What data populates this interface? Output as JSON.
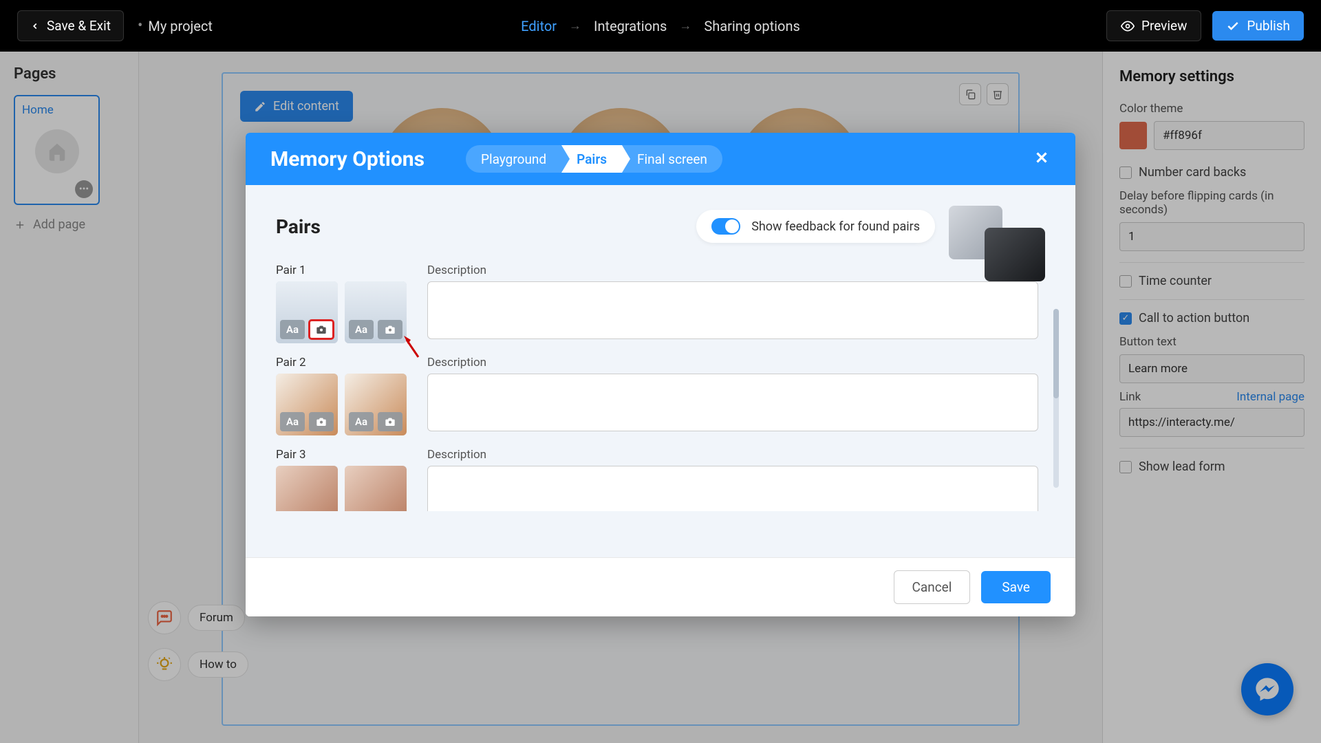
{
  "topbar": {
    "save_exit": "Save & Exit",
    "project_name": "My project",
    "nav": {
      "editor": "Editor",
      "integrations": "Integrations",
      "sharing": "Sharing options"
    },
    "preview": "Preview",
    "publish": "Publish"
  },
  "left_panel": {
    "title": "Pages",
    "home_label": "Home",
    "add_page": "Add page"
  },
  "canvas": {
    "edit_content": "Edit content"
  },
  "right_panel": {
    "title": "Memory settings",
    "color_theme_label": "Color theme",
    "color_hex": "#ff896f",
    "number_backs": "Number card backs",
    "delay_label": "Delay before flipping cards (in seconds)",
    "delay_value": "1",
    "time_counter": "Time counter",
    "cta_label": "Call to action button",
    "button_text_label": "Button text",
    "button_text_value": "Learn more",
    "link_label": "Link",
    "internal_page": "Internal page",
    "link_value": "https://interacty.me/",
    "show_lead": "Show lead form"
  },
  "help": {
    "forum": "Forum",
    "howto": "How to"
  },
  "modal": {
    "title": "Memory Options",
    "tabs": {
      "playground": "Playground",
      "pairs": "Pairs",
      "final": "Final screen"
    },
    "section_title": "Pairs",
    "feedback_label": "Show feedback for found pairs",
    "desc_label": "Description",
    "pairs": [
      {
        "label": "Pair 1",
        "highlight_cam": true
      },
      {
        "label": "Pair 2",
        "highlight_cam": false
      },
      {
        "label": "Pair 3",
        "highlight_cam": false
      }
    ],
    "cancel": "Cancel",
    "save": "Save",
    "tool_text": "Aa"
  }
}
